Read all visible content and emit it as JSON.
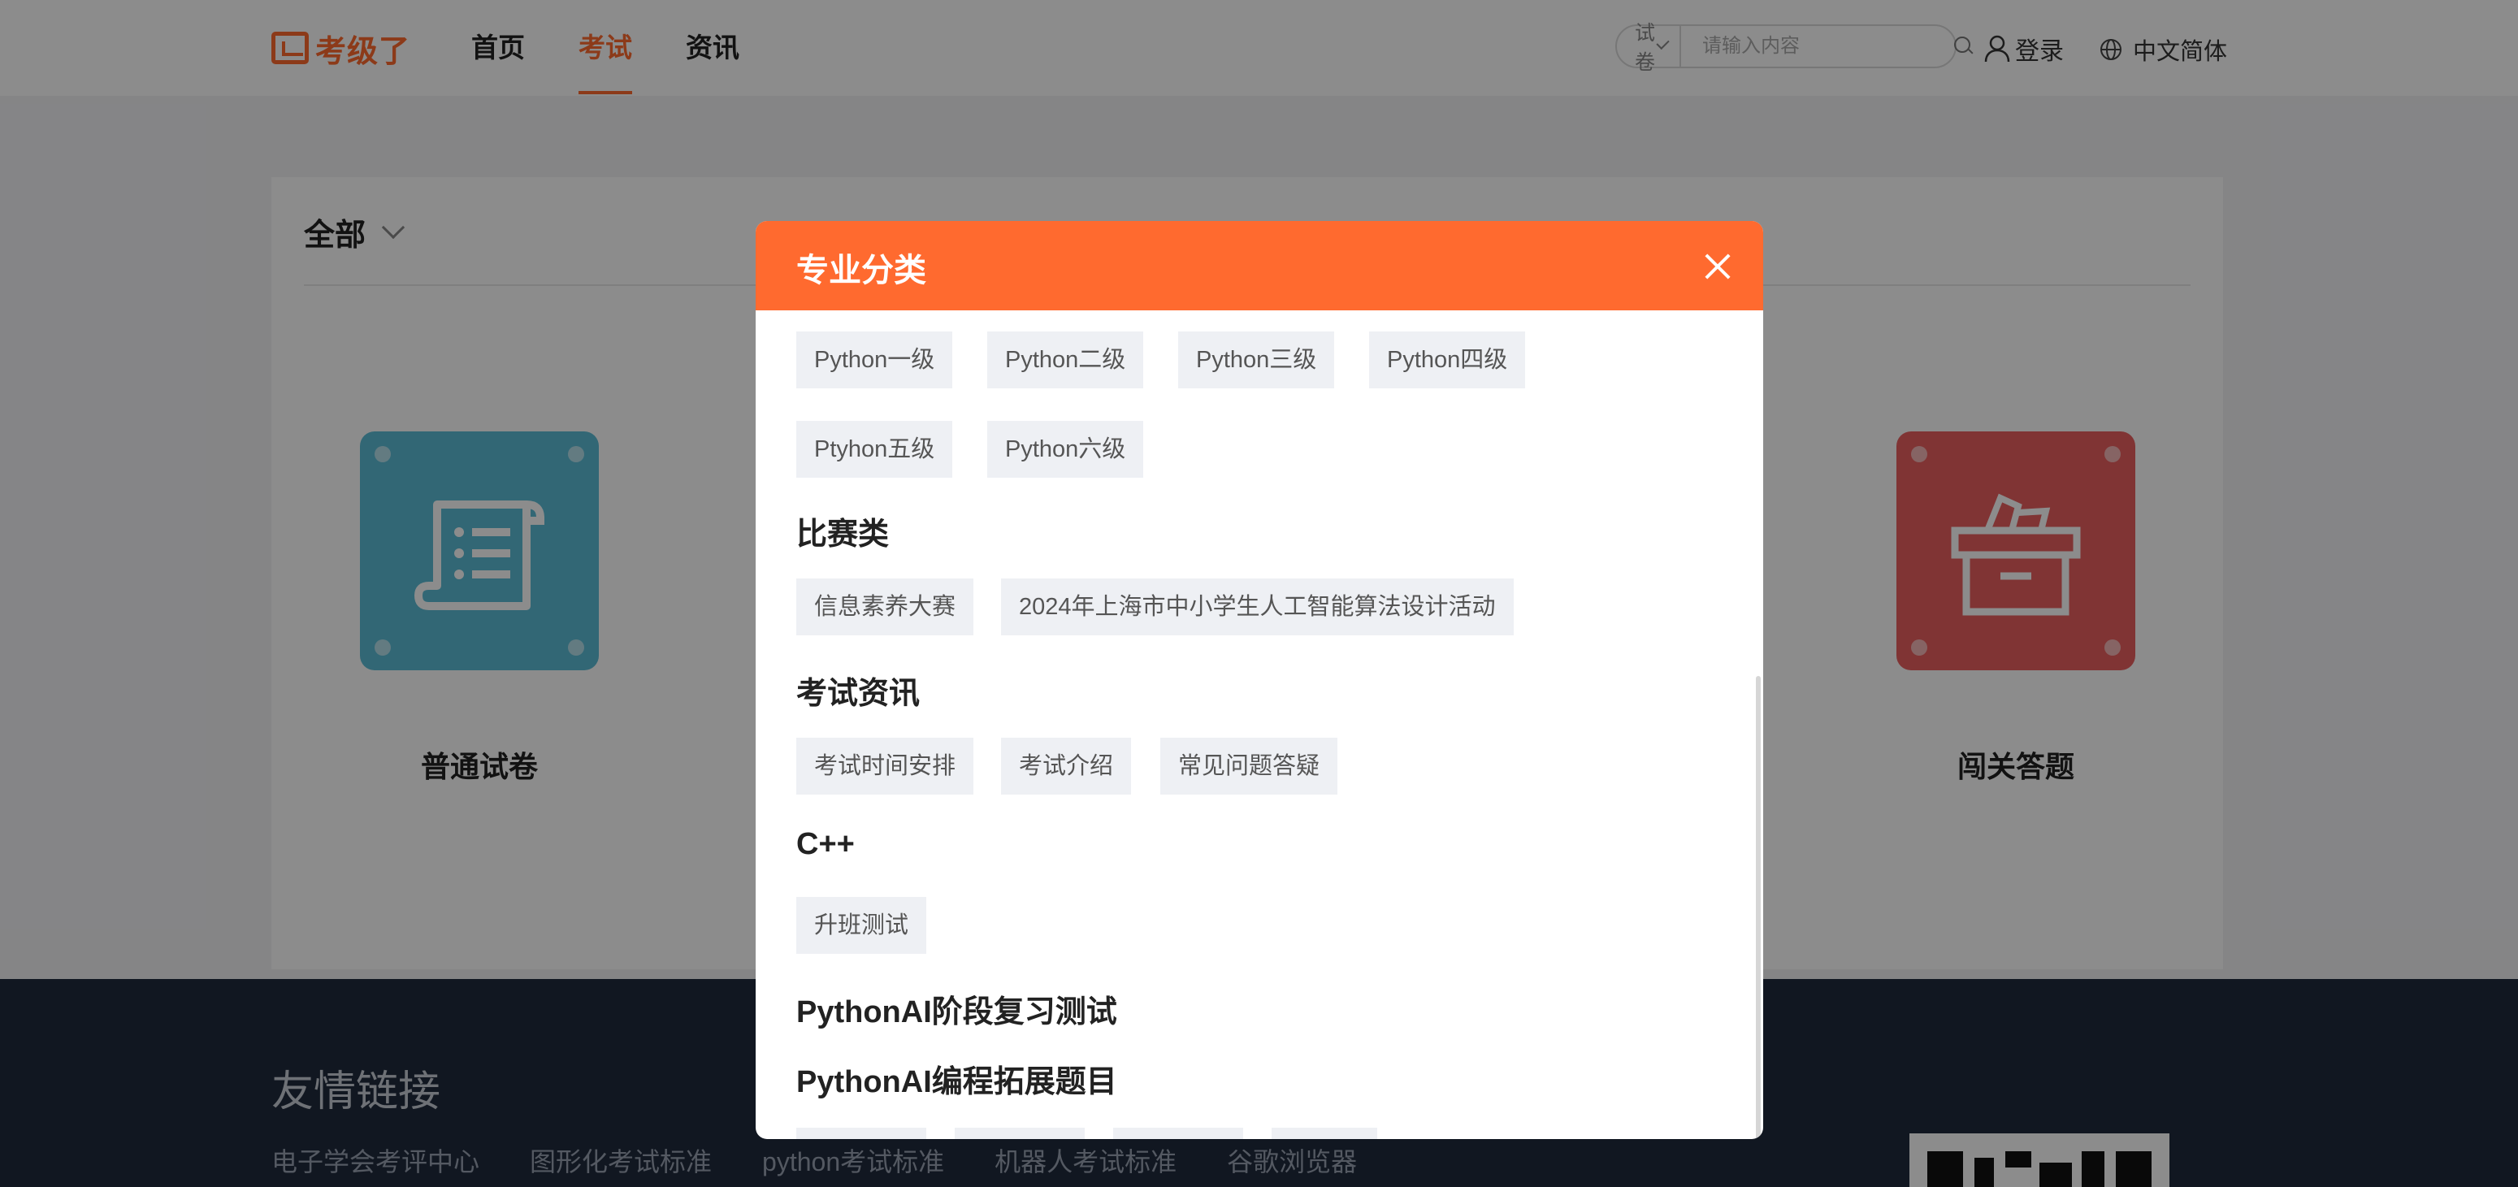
{
  "header": {
    "logo_text": "考级了",
    "nav": [
      "首页",
      "考试",
      "资讯"
    ],
    "active_nav": 1,
    "search": {
      "select_label": "试卷",
      "placeholder": "请输入内容"
    },
    "login_label": "登录",
    "language_label": "中文简体"
  },
  "main": {
    "filter_label": "全部",
    "tiles": [
      {
        "title": "普通试卷",
        "color": "#5bbcd6"
      },
      {
        "title": "闯关答题",
        "color": "#e96060"
      }
    ]
  },
  "footer": {
    "title": "友情链接",
    "links": [
      "电子学会考评中心",
      "图形化考试标准",
      "python考试标准",
      "机器人考试标准",
      "谷歌浏览器"
    ]
  },
  "modal": {
    "title": "专业分类",
    "python_tags": [
      "Python一级",
      "Python二级",
      "Python三级",
      "Python四级",
      "Ptyhon五级",
      "Python六级"
    ],
    "categories": [
      {
        "title": "比赛类",
        "tags": [
          "信息素养大赛",
          "2024年上海市中小学生人工智能算法设计活动"
        ]
      },
      {
        "title": "考试资讯",
        "tags": [
          "考试时间安排",
          "考试介绍",
          "常见问题答疑"
        ]
      },
      {
        "title": "C++",
        "tags": [
          "升班测试"
        ]
      },
      {
        "title": "PythonAI阶段复习测试",
        "tags": []
      },
      {
        "title": "PythonAI编程拓展题目",
        "tags": []
      }
    ]
  },
  "colors": {
    "accent": "#ff6a2f",
    "footer_bg": "#1f2a3c"
  }
}
